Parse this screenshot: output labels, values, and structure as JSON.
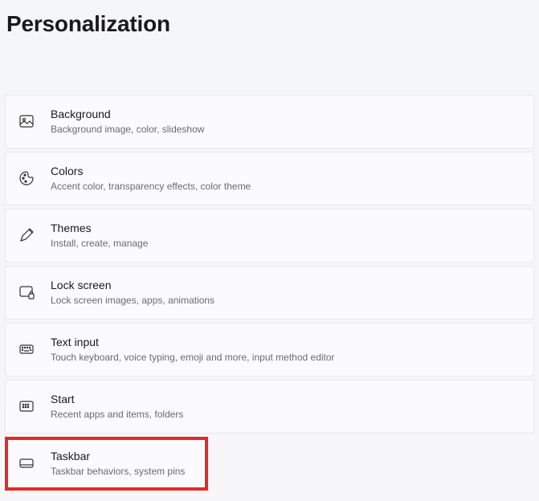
{
  "page": {
    "title": "Personalization"
  },
  "items": [
    {
      "icon": "picture-icon",
      "title": "Background",
      "subtitle": "Background image, color, slideshow"
    },
    {
      "icon": "palette-icon",
      "title": "Colors",
      "subtitle": "Accent color, transparency effects, color theme"
    },
    {
      "icon": "pen-icon",
      "title": "Themes",
      "subtitle": "Install, create, manage"
    },
    {
      "icon": "lockscreen-icon",
      "title": "Lock screen",
      "subtitle": "Lock screen images, apps, animations"
    },
    {
      "icon": "keyboard-icon",
      "title": "Text input",
      "subtitle": "Touch keyboard, voice typing, emoji and more, input method editor"
    },
    {
      "icon": "start-icon",
      "title": "Start",
      "subtitle": "Recent apps and items, folders"
    },
    {
      "icon": "taskbar-icon",
      "title": "Taskbar",
      "subtitle": "Taskbar behaviors, system pins"
    }
  ]
}
